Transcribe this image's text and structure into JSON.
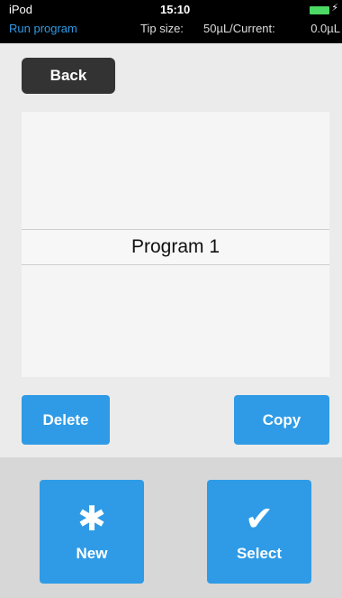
{
  "status": {
    "carrier": "iPod",
    "time": "15:10",
    "bolt_icon": "⚡"
  },
  "header": {
    "screen_title": "Run program",
    "tip_label": "Tip size:",
    "tip_value": "50µL/Current:",
    "current_value": "0.0µL"
  },
  "nav": {
    "back_label": "Back"
  },
  "programs": [
    "Program 1"
  ],
  "actions": {
    "delete_label": "Delete",
    "copy_label": "Copy",
    "new_label": "New",
    "new_icon": "✱",
    "select_label": "Select",
    "select_icon": "✔"
  },
  "colors": {
    "accent": "#2f9be6",
    "battery": "#4cd964"
  }
}
